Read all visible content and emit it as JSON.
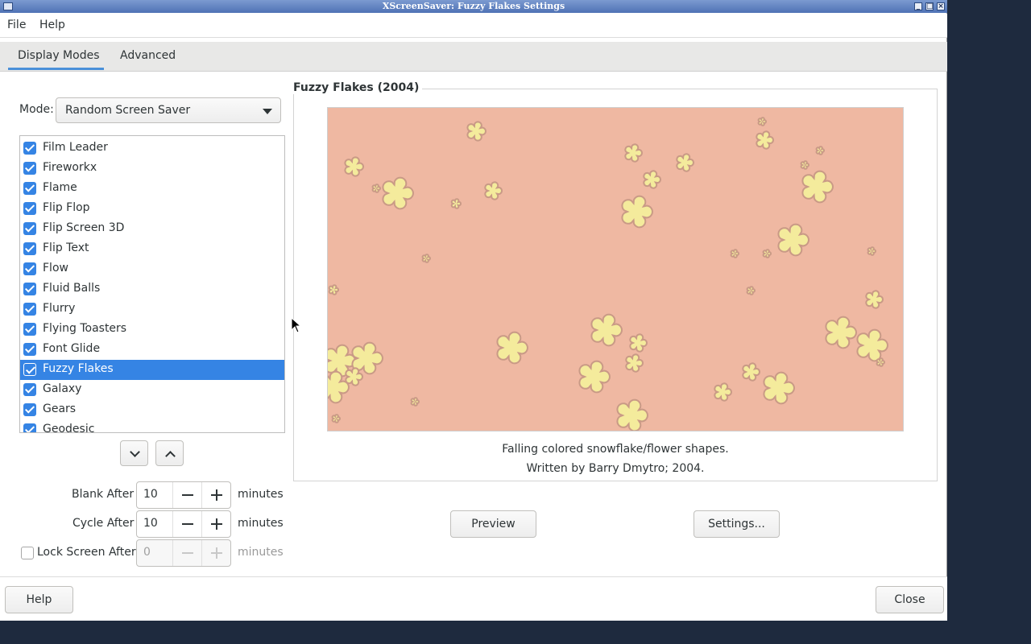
{
  "window": {
    "title": "XScreenSaver: Fuzzy Flakes Settings"
  },
  "menu": {
    "file": "File",
    "help": "Help"
  },
  "tabs": [
    {
      "label": "Display Modes"
    },
    {
      "label": "Advanced"
    }
  ],
  "mode": {
    "label": "Mode:",
    "value": "Random Screen Saver"
  },
  "list": {
    "items": [
      {
        "label": "Film Leader",
        "checked": true
      },
      {
        "label": "Fireworkx",
        "checked": true
      },
      {
        "label": "Flame",
        "checked": true
      },
      {
        "label": "Flip Flop",
        "checked": true
      },
      {
        "label": "Flip Screen 3D",
        "checked": true
      },
      {
        "label": "Flip Text",
        "checked": true
      },
      {
        "label": "Flow",
        "checked": true
      },
      {
        "label": "Fluid Balls",
        "checked": true
      },
      {
        "label": "Flurry",
        "checked": true
      },
      {
        "label": "Flying Toasters",
        "checked": true
      },
      {
        "label": "Font Glide",
        "checked": true
      },
      {
        "label": "Fuzzy Flakes",
        "checked": true,
        "selected": true
      },
      {
        "label": "Galaxy",
        "checked": true
      },
      {
        "label": "Gears",
        "checked": true
      },
      {
        "label": "Geodesic",
        "checked": true
      }
    ]
  },
  "timers": {
    "blank": {
      "label": "Blank After",
      "value": "10",
      "unit": "minutes"
    },
    "cycle": {
      "label": "Cycle After",
      "value": "10",
      "unit": "minutes"
    },
    "lock": {
      "label": "Lock Screen After",
      "value": "0",
      "unit": "minutes",
      "checked": false
    }
  },
  "preview": {
    "title": "Fuzzy Flakes (2004)",
    "description": "Falling colored snowflake/flower shapes.",
    "credit": "Written by Barry Dmytro; 2004.",
    "bg_color": "#efb8a2",
    "flake_color": "#f4eb9c"
  },
  "buttons": {
    "preview": "Preview",
    "settings": "Settings...",
    "help": "Help",
    "close": "Close"
  },
  "colors": {
    "accent": "#3584e4",
    "titlebar": "#4f72b5"
  }
}
